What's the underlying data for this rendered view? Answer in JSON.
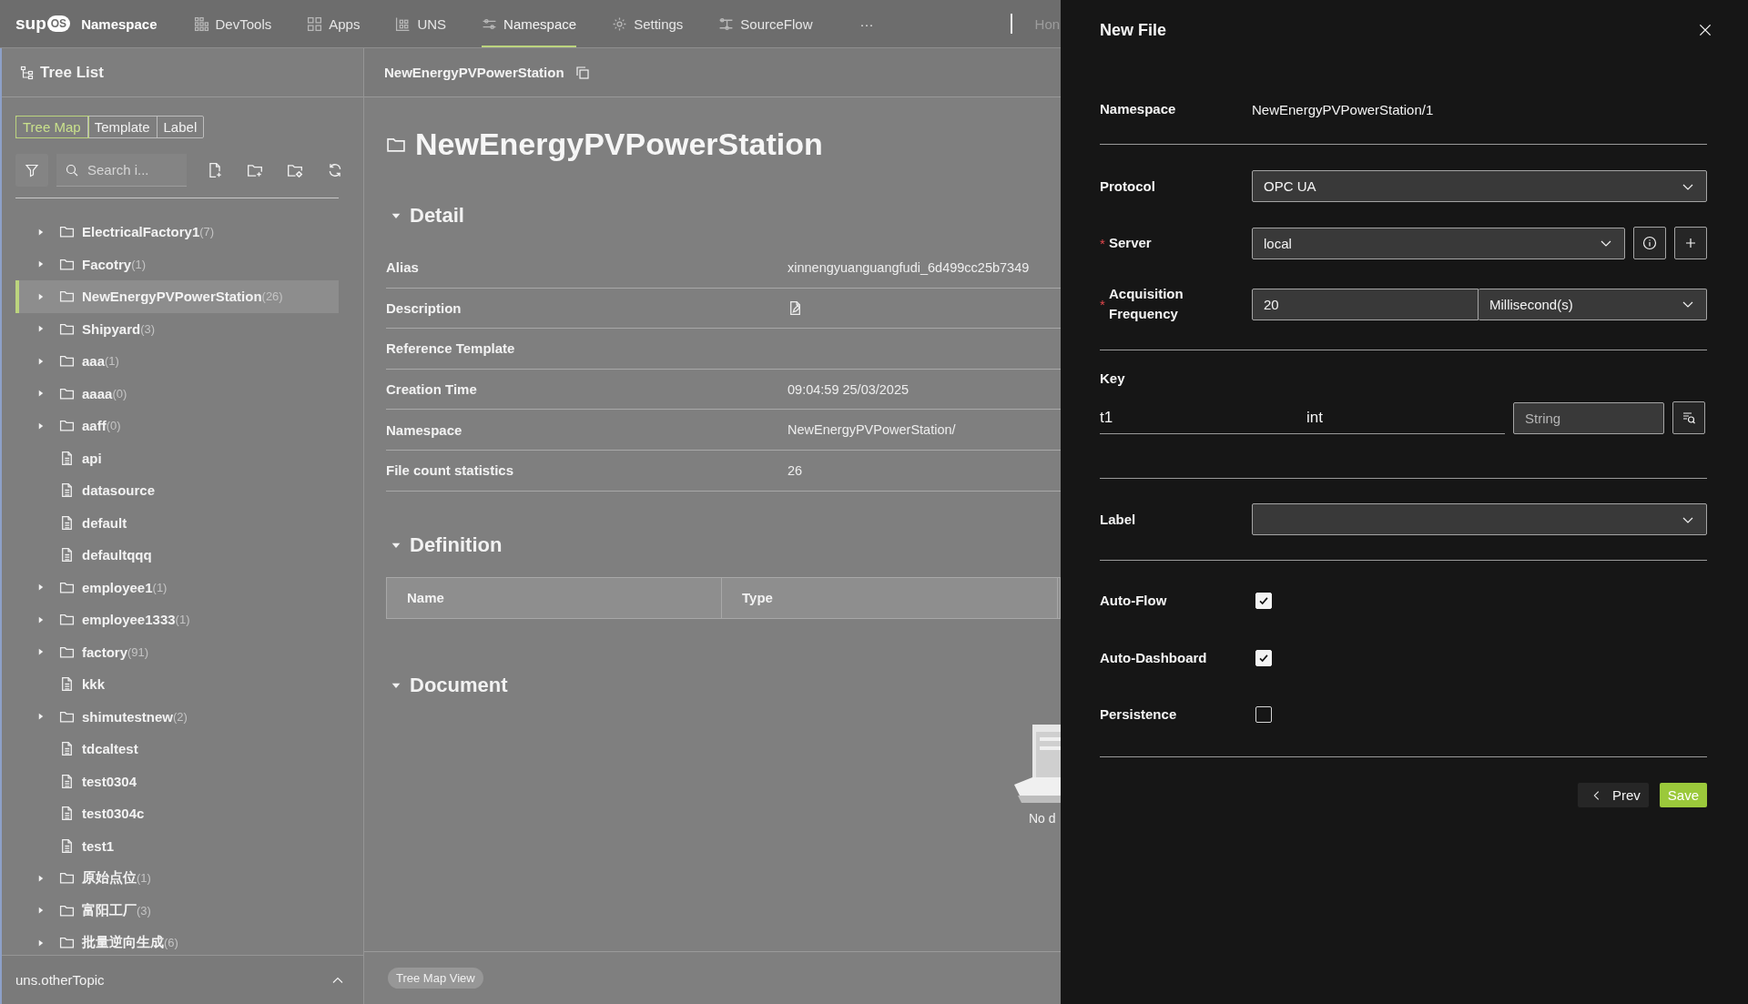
{
  "top_bar": {
    "logo": {
      "text": "sup",
      "badge": "OS"
    },
    "app_title": "Namespace",
    "nav": [
      {
        "label": "DevTools",
        "selected": false
      },
      {
        "label": "Apps",
        "selected": false
      },
      {
        "label": "UNS",
        "selected": false
      },
      {
        "label": "Namespace",
        "selected": true
      },
      {
        "label": "Settings",
        "selected": false
      },
      {
        "label": "SourceFlow",
        "selected": false
      }
    ],
    "more": "···",
    "cut_item": "Hon"
  },
  "sidebar": {
    "title": "Tree List",
    "tabs": [
      {
        "label": "Tree Map",
        "selected": true
      },
      {
        "label": "Template",
        "selected": false
      },
      {
        "label": "Label",
        "selected": false
      }
    ],
    "search": {
      "placeholder": "Search i..."
    },
    "tree": [
      {
        "kind": "folder",
        "name": "ElectricalFactory1",
        "count": "(7)",
        "expanded": false,
        "selected": false
      },
      {
        "kind": "folder",
        "name": "Facotry",
        "count": "(1)",
        "expanded": false,
        "selected": false
      },
      {
        "kind": "folder",
        "name": "NewEnergyPVPowerStation",
        "count": "(26)",
        "expanded": false,
        "selected": true
      },
      {
        "kind": "folder",
        "name": "Shipyard",
        "count": "(3)",
        "expanded": false,
        "selected": false
      },
      {
        "kind": "folder",
        "name": "aaa",
        "count": "(1)",
        "expanded": false,
        "selected": false
      },
      {
        "kind": "folder",
        "name": "aaaa",
        "count": "(0)",
        "expanded": false,
        "selected": false
      },
      {
        "kind": "folder",
        "name": "aaff",
        "count": "(0)",
        "expanded": false,
        "selected": false
      },
      {
        "kind": "file",
        "name": "api",
        "selected": false
      },
      {
        "kind": "file",
        "name": "datasource",
        "selected": false
      },
      {
        "kind": "file",
        "name": "default",
        "selected": false
      },
      {
        "kind": "file",
        "name": "defaultqqq",
        "selected": false
      },
      {
        "kind": "folder",
        "name": "employee1",
        "count": "(1)",
        "expanded": false,
        "selected": false
      },
      {
        "kind": "folder",
        "name": "employee1333",
        "count": "(1)",
        "expanded": false,
        "selected": false
      },
      {
        "kind": "folder",
        "name": "factory",
        "count": "(91)",
        "expanded": false,
        "selected": false
      },
      {
        "kind": "file",
        "name": "kkk",
        "selected": false
      },
      {
        "kind": "folder",
        "name": "shimutestnew",
        "count": "(2)",
        "expanded": false,
        "selected": false
      },
      {
        "kind": "file",
        "name": "tdcaltest",
        "selected": false
      },
      {
        "kind": "file",
        "name": "test0304",
        "selected": false
      },
      {
        "kind": "file",
        "name": "test0304c",
        "selected": false
      },
      {
        "kind": "file",
        "name": "test1",
        "selected": false
      },
      {
        "kind": "folder",
        "name": "原始点位",
        "count": "(1)",
        "expanded": false,
        "selected": false
      },
      {
        "kind": "folder",
        "name": "富阳工厂",
        "count": "(3)",
        "expanded": false,
        "selected": false
      },
      {
        "kind": "folder",
        "name": "批量逆向生成",
        "count": "(6)",
        "expanded": false,
        "selected": false
      }
    ],
    "footer": "uns.otherTopic"
  },
  "main": {
    "breadcrumb": "NewEnergyPVPowerStation",
    "title": "NewEnergyPVPowerStation",
    "sections": [
      {
        "kind": "details",
        "title": "Detail",
        "expanded": true,
        "rows": [
          {
            "kind": "text",
            "label": "Alias",
            "value": "xinnengyuanguangfudi_6d499cc25b7349"
          },
          {
            "kind": "icon",
            "label": "Description"
          },
          {
            "kind": "text",
            "label": "Reference Template"
          },
          {
            "kind": "text",
            "label": "Creation Time",
            "value": "09:04:59 25/03/2025"
          },
          {
            "kind": "text",
            "label": "Namespace",
            "value": "NewEnergyPVPowerStation/"
          },
          {
            "kind": "text",
            "label": "File count statistics",
            "value": "26"
          }
        ]
      },
      {
        "kind": "table",
        "title": "Definition",
        "expanded": true,
        "columns": [
          "Name",
          "Type"
        ]
      },
      {
        "kind": "empty",
        "title": "Document",
        "expanded": true,
        "message": "No d"
      }
    ],
    "bottom_tab": "Tree Map View"
  },
  "drawer": {
    "title": "New File",
    "sections": [
      [
        {
          "kind": "text",
          "label": "Namespace",
          "value": "NewEnergyPVPowerStation/1"
        }
      ],
      [
        {
          "kind": "select",
          "label": "Protocol",
          "value": "OPC UA"
        },
        {
          "kind": "server",
          "label": "Server",
          "required_mark": "*",
          "value": "local"
        },
        {
          "kind": "frequency",
          "label": "Acquisition Frequency",
          "required_mark": "*",
          "value": "20",
          "unit": "Millisecond(s)"
        }
      ],
      [
        {
          "kind": "key",
          "label": "Key",
          "name": "t1",
          "type": "int",
          "placeholder": "String"
        }
      ],
      [
        {
          "kind": "select",
          "label": "Label"
        }
      ],
      [
        {
          "kind": "checkbox",
          "label": "Auto-Flow",
          "checked": true
        },
        {
          "kind": "checkbox",
          "label": "Auto-Dashboard",
          "checked": true
        },
        {
          "kind": "checkbox",
          "label": "Persistence",
          "checked": false
        }
      ]
    ],
    "buttons": [
      {
        "kind": "back",
        "label": "Prev"
      },
      {
        "kind": "primary",
        "label": "Save"
      }
    ]
  }
}
